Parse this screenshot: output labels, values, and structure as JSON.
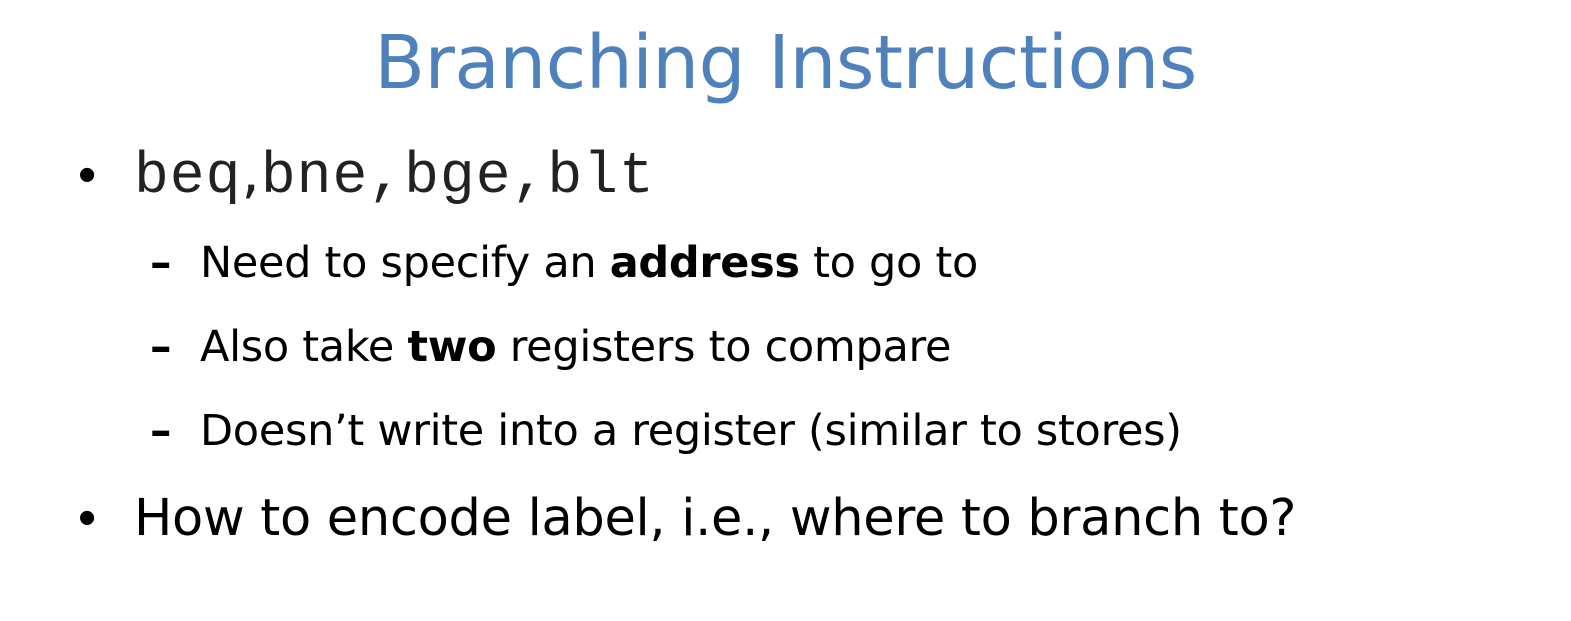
{
  "slide": {
    "title": "Branching Instructions",
    "bullets": [
      {
        "marker": "•",
        "code": [
          "beq",
          "bne",
          "bge",
          "blt"
        ],
        "separators": [
          ",",
          ",",
          ","
        ]
      },
      {
        "marker": "•",
        "text": "How to encode label, i.e., where to branch to?"
      }
    ],
    "sub_bullets": [
      {
        "marker": "–",
        "pre": "Need to specify an ",
        "bold": "address",
        "post": " to go to"
      },
      {
        "marker": "–",
        "pre": "Also take ",
        "bold": "two",
        "post": " registers to compare"
      },
      {
        "marker": "–",
        "pre": "Doesn’t write into a register (similar to stores)",
        "bold": "",
        "post": ""
      }
    ],
    "colors": {
      "title": "#4f81bd",
      "text": "#000000"
    }
  }
}
